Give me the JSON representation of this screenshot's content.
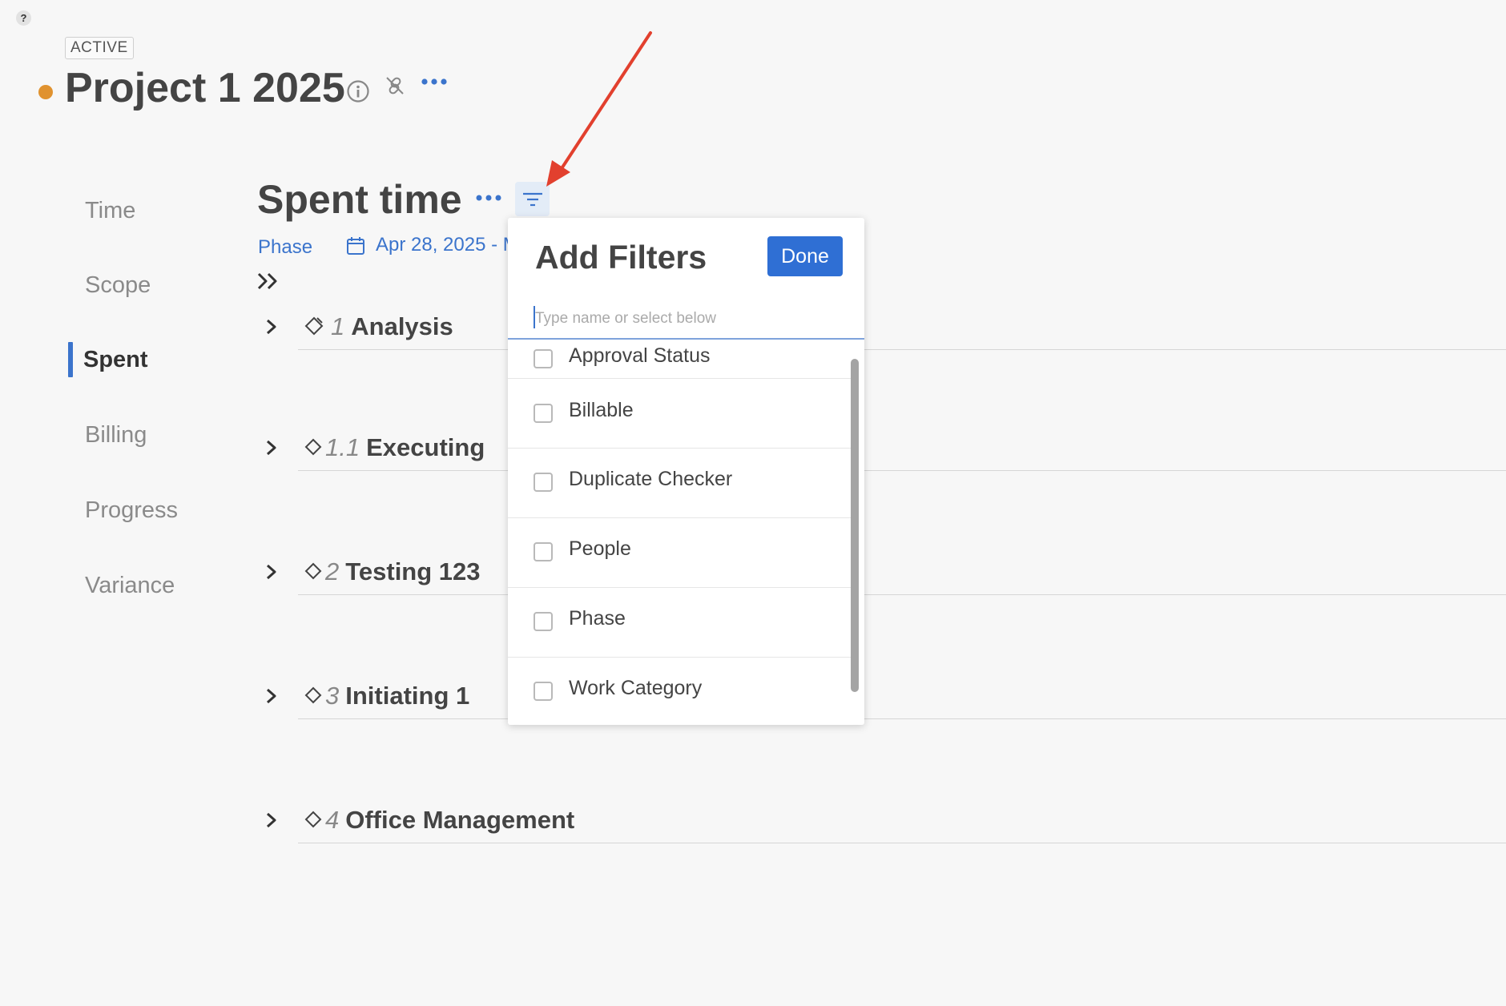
{
  "help": {
    "label": "?"
  },
  "project": {
    "status": "ACTIVE",
    "title": "Project 1 2025",
    "status_color": "#e0922f"
  },
  "sidebar": {
    "items": [
      {
        "label": "Time",
        "active": false
      },
      {
        "label": "Scope",
        "active": false
      },
      {
        "label": "Spent",
        "active": true
      },
      {
        "label": "Billing",
        "active": false
      },
      {
        "label": "Progress",
        "active": false
      },
      {
        "label": "Variance",
        "active": false
      }
    ]
  },
  "main": {
    "title": "Spent time",
    "group_by": "Phase",
    "date_range": "Apr 28, 2025 - M",
    "rows": [
      {
        "num": "1",
        "label": "Analysis"
      },
      {
        "num": "1.1",
        "label": "Executing"
      },
      {
        "num": "2",
        "label": "Testing 123"
      },
      {
        "num": "3",
        "label": "Initiating 1"
      },
      {
        "num": "4",
        "label": "Office Management"
      }
    ]
  },
  "filters": {
    "title": "Add Filters",
    "done_label": "Done",
    "search_placeholder": "Type name or select below",
    "options": [
      {
        "label": "Approval Status",
        "checked": false
      },
      {
        "label": "Billable",
        "checked": false
      },
      {
        "label": "Duplicate Checker",
        "checked": false
      },
      {
        "label": "People",
        "checked": false
      },
      {
        "label": "Phase",
        "checked": false
      },
      {
        "label": "Work Category",
        "checked": false
      }
    ]
  },
  "colors": {
    "accent": "#3b74cc",
    "button": "#2f6fd4",
    "annotation_arrow": "#e2402e"
  }
}
